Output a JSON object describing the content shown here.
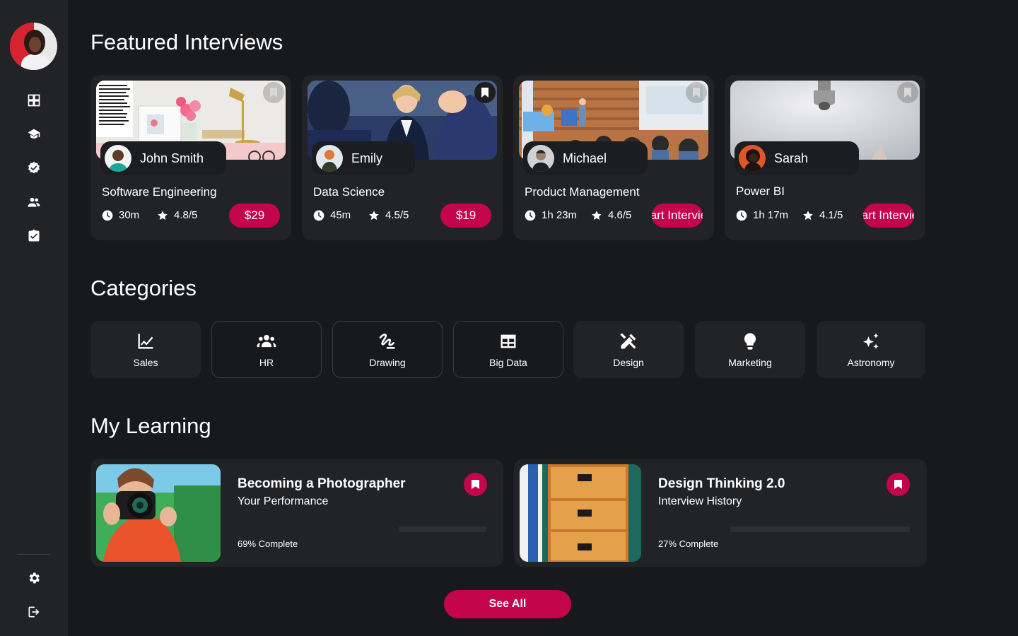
{
  "colors": {
    "accent": "#c4054c",
    "background": "#18191c",
    "surface": "#222326"
  },
  "sidebar": {
    "items": [
      {
        "name": "dashboard-icon"
      },
      {
        "name": "school-icon"
      },
      {
        "name": "verified-icon"
      },
      {
        "name": "people-icon"
      },
      {
        "name": "assignment-icon"
      }
    ],
    "bottom": [
      {
        "name": "settings-icon"
      },
      {
        "name": "logout-icon"
      }
    ]
  },
  "featured": {
    "title": "Featured Interviews",
    "cards": [
      {
        "author": "John Smith",
        "title": "Software Engineering",
        "duration": "30m",
        "rating": "4.8/5",
        "button": "$29",
        "bookmarked": false
      },
      {
        "author": "Emily",
        "title": "Data Science",
        "duration": "45m",
        "rating": "4.5/5",
        "button": "$19",
        "bookmarked": true
      },
      {
        "author": "Michael",
        "title": "Product Management",
        "duration": "1h 23m",
        "rating": "4.6/5",
        "button": "Start Interview",
        "bookmarked": false
      },
      {
        "author": "Sarah",
        "title": "Power BI",
        "duration": "1h 17m",
        "rating": "4.1/5",
        "button": "Start Interview",
        "bookmarked": false
      }
    ]
  },
  "categories": {
    "title": "Categories",
    "items": [
      {
        "label": "Sales",
        "icon": "chart-line-icon",
        "outlined": false
      },
      {
        "label": "HR",
        "icon": "groups-icon",
        "outlined": true
      },
      {
        "label": "Drawing",
        "icon": "gesture-icon",
        "outlined": true
      },
      {
        "label": "Big Data",
        "icon": "table-icon",
        "outlined": true
      },
      {
        "label": "Design",
        "icon": "design-tools-icon",
        "outlined": false
      },
      {
        "label": "Marketing",
        "icon": "lightbulb-icon",
        "outlined": false
      },
      {
        "label": "Astronomy",
        "icon": "sparkles-icon",
        "outlined": false
      }
    ]
  },
  "learning": {
    "title": "My Learning",
    "items": [
      {
        "title": "Becoming a Photographer",
        "subtitle": "Your Performance",
        "progress_label": "69% Complete",
        "progress": 0.69
      },
      {
        "title": "Design Thinking 2.0",
        "subtitle": "Interview History",
        "progress_label": "27% Complete",
        "progress": 0.27
      }
    ],
    "see_all": "See All"
  }
}
